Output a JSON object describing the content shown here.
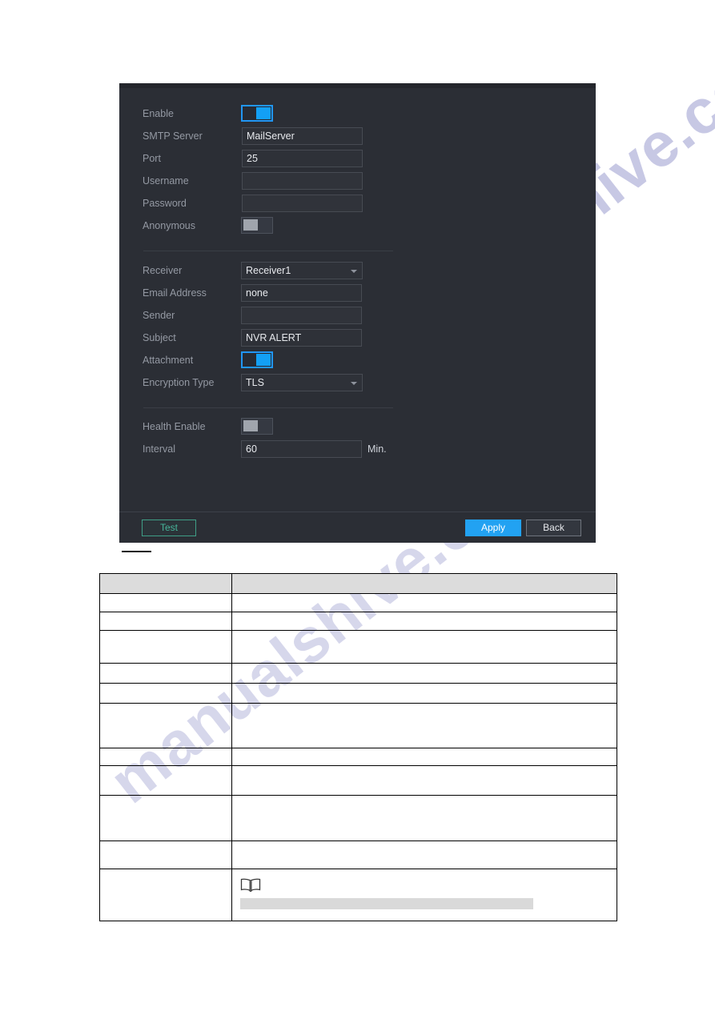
{
  "watermark": {
    "text_top": "manualshive.com",
    "text_bottom": "manualshive.com"
  },
  "dialog": {
    "title": "",
    "fields": [
      {
        "label": "Enable",
        "type": "toggle",
        "state": "on",
        "value": ""
      },
      {
        "label": "SMTP Server",
        "type": "text",
        "value": "MailServer"
      },
      {
        "label": "Port",
        "type": "text",
        "value": "25"
      },
      {
        "label": "Username",
        "type": "text",
        "value": ""
      },
      {
        "label": "Password",
        "type": "password",
        "value": ""
      },
      {
        "label": "Anonymous",
        "type": "toggle",
        "state": "off",
        "value": ""
      },
      {
        "label": "Receiver",
        "type": "select",
        "value": "Receiver1"
      },
      {
        "label": "Email Address",
        "type": "text",
        "value": "none"
      },
      {
        "label": "Sender",
        "type": "text",
        "value": ""
      },
      {
        "label": "Subject",
        "type": "text",
        "value": "NVR ALERT"
      },
      {
        "label": "Attachment",
        "type": "toggle",
        "state": "on",
        "value": ""
      },
      {
        "label": "Encryption Type",
        "type": "select",
        "value": "TLS"
      },
      {
        "label": "Health Enable",
        "type": "toggle",
        "state": "off",
        "value": ""
      },
      {
        "label": "Interval",
        "type": "text",
        "value": "60",
        "unit": "Min."
      }
    ],
    "buttons": {
      "test": "Test",
      "apply": "Apply",
      "back": "Back"
    },
    "colors": {
      "background": "#2b2e35",
      "accent_blue": "#13a0f5",
      "apply_blue": "#22a2f2",
      "test_green": "#46b49a",
      "label_gray": "#9499a3"
    }
  },
  "spec_table": {
    "header": [
      "",
      ""
    ],
    "rows": [
      {
        "name": "",
        "description": "",
        "height": 24
      },
      {
        "name": "",
        "description": "",
        "height": 26
      },
      {
        "name": "",
        "description": "",
        "height": 42
      },
      {
        "name": "",
        "description": "",
        "height": 26
      },
      {
        "name": "",
        "description": "",
        "height": 25
      },
      {
        "name": "",
        "description": "",
        "height": 57
      },
      {
        "name": "",
        "description": "",
        "height": 22
      },
      {
        "name": "",
        "description": "",
        "height": 38
      },
      {
        "name": "",
        "description": "",
        "height": 58
      },
      {
        "name": "",
        "description": "",
        "height": 36
      },
      {
        "name": "",
        "description": "",
        "height": 66,
        "note_icon": "book-icon",
        "note_bar": true
      }
    ]
  }
}
